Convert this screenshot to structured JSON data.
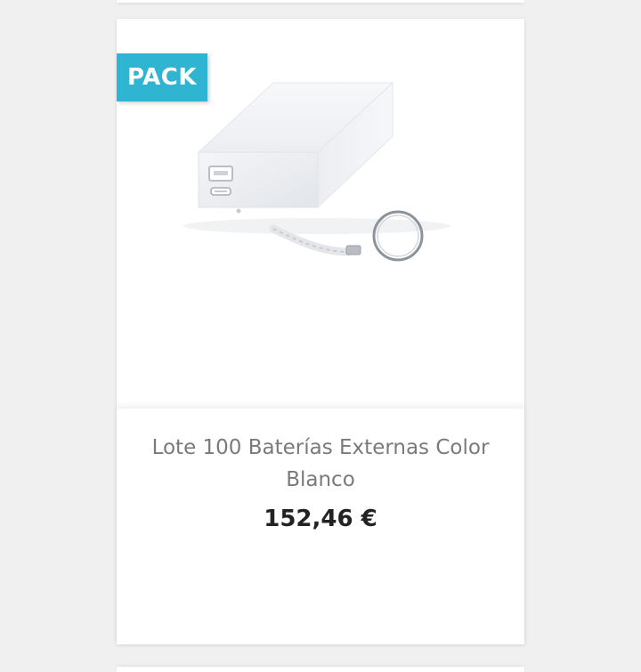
{
  "product": {
    "badge": "PACK",
    "title": "Lote 100 Baterías Externas Color Blanco",
    "price": "152,46 €",
    "image_icon": "power-bank-keychain-image"
  },
  "colors": {
    "badge_bg": "#2fb5d2",
    "badge_text": "#ffffff",
    "title_text": "#7a7a7a",
    "price_text": "#232323",
    "page_bg": "#f0f0f0",
    "card_bg": "#ffffff"
  }
}
